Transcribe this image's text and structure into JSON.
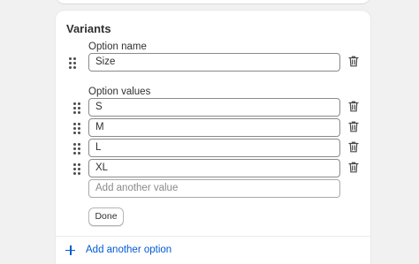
{
  "section": {
    "title": "Variants"
  },
  "option": {
    "name_label": "Option name",
    "name_value": "Size",
    "values_label": "Option values",
    "values": [
      "S",
      "M",
      "L",
      "XL"
    ],
    "add_value_placeholder": "Add another value",
    "done_label": "Done"
  },
  "add_option_label": "Add another option",
  "colors": {
    "accent": "#005bd3",
    "border": "#8a8a8a",
    "text": "#303030"
  }
}
